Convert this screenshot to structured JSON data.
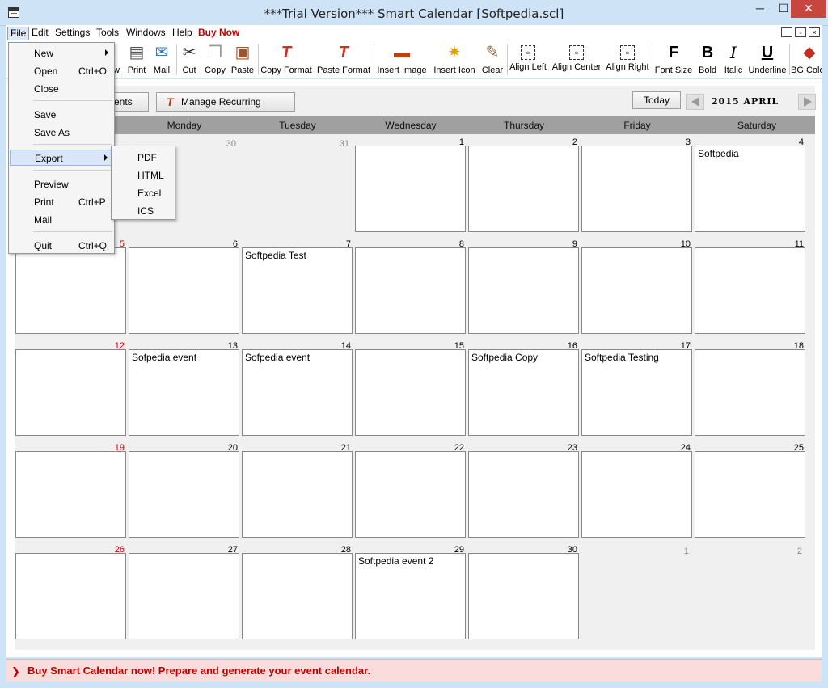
{
  "window": {
    "title": "***Trial Version*** Smart Calendar [Softpedia.scl]",
    "min": "─",
    "max": "☐",
    "close": "✕"
  },
  "menu": {
    "file": "File",
    "edit": "Edit",
    "settings": "Settings",
    "tools": "Tools",
    "windows": "Windows",
    "help": "Help",
    "buy": "Buy Now"
  },
  "mdi": {
    "min": "_",
    "restore": "▫",
    "close": "×"
  },
  "toolbar": [
    {
      "label": "w",
      "icon": ""
    },
    {
      "label": "Print",
      "icon": "▤"
    },
    {
      "label": "Mail",
      "icon": "✉"
    },
    {
      "label": "Cut",
      "icon": "✂"
    },
    {
      "label": "Copy",
      "icon": "❐"
    },
    {
      "label": "Paste",
      "icon": "▣"
    },
    {
      "label": "Copy Format",
      "icon": "T"
    },
    {
      "label": "Paste Format",
      "icon": "T"
    },
    {
      "label": "Insert Image",
      "icon": "▬"
    },
    {
      "label": "Insert Icon",
      "icon": "✷"
    },
    {
      "label": "Clear",
      "icon": "✎"
    },
    {
      "label": "Align Left",
      "icon": "▫"
    },
    {
      "label": "Align Center",
      "icon": "▫"
    },
    {
      "label": "Align Right",
      "icon": "▫"
    },
    {
      "label": "Font Size",
      "icon": "F"
    },
    {
      "label": "Bold",
      "icon": "B"
    },
    {
      "label": "Italic",
      "icon": "I"
    },
    {
      "label": "Underline",
      "icon": "U"
    },
    {
      "label": "BG Colo",
      "icon": "◆"
    }
  ],
  "calendar": {
    "events_button_partial": "ents",
    "recurring_button": "Manage Recurring Events",
    "today_button": "Today",
    "month_label": "2015 APRIL",
    "days": [
      "Monday",
      "Tuesday",
      "Wednesday",
      "Thursday",
      "Friday",
      "Saturday"
    ],
    "weeks": [
      [
        {
          "n": "",
          "ev": ""
        },
        {
          "n": "30",
          "ev": "",
          "other": true
        },
        {
          "n": "31",
          "ev": "",
          "other": true
        },
        {
          "n": "1",
          "ev": ""
        },
        {
          "n": "2",
          "ev": ""
        },
        {
          "n": "3",
          "ev": ""
        },
        {
          "n": "4",
          "ev": "Softpedia"
        }
      ],
      [
        {
          "n": "5",
          "ev": "",
          "sun": true
        },
        {
          "n": "6",
          "ev": ""
        },
        {
          "n": "7",
          "ev": "Softpedia Test"
        },
        {
          "n": "8",
          "ev": ""
        },
        {
          "n": "9",
          "ev": ""
        },
        {
          "n": "10",
          "ev": ""
        },
        {
          "n": "11",
          "ev": ""
        }
      ],
      [
        {
          "n": "12",
          "ev": "",
          "sun": true
        },
        {
          "n": "13",
          "ev": "Sofpedia event"
        },
        {
          "n": "14",
          "ev": "Sofpedia event"
        },
        {
          "n": "15",
          "ev": ""
        },
        {
          "n": "16",
          "ev": "Softpedia Copy"
        },
        {
          "n": "17",
          "ev": "Softpedia Testing"
        },
        {
          "n": "18",
          "ev": ""
        }
      ],
      [
        {
          "n": "19",
          "ev": "",
          "sun": true
        },
        {
          "n": "20",
          "ev": ""
        },
        {
          "n": "21",
          "ev": ""
        },
        {
          "n": "22",
          "ev": ""
        },
        {
          "n": "23",
          "ev": ""
        },
        {
          "n": "24",
          "ev": ""
        },
        {
          "n": "25",
          "ev": ""
        }
      ],
      [
        {
          "n": "26",
          "ev": "",
          "sun": true
        },
        {
          "n": "27",
          "ev": ""
        },
        {
          "n": "28",
          "ev": ""
        },
        {
          "n": "29",
          "ev": "Softpedia event 2"
        },
        {
          "n": "30",
          "ev": ""
        },
        {
          "n": "1",
          "ev": "",
          "other": true
        },
        {
          "n": "2",
          "ev": "",
          "other": true
        }
      ]
    ]
  },
  "file_menu": {
    "new": "New",
    "open": "Open",
    "open_sc": "Ctrl+O",
    "close": "Close",
    "save": "Save",
    "save_as": "Save As",
    "export": "Export",
    "preview": "Preview",
    "print": "Print",
    "print_sc": "Ctrl+P",
    "mail": "Mail",
    "quit": "Quit",
    "quit_sc": "Ctrl+Q"
  },
  "export_menu": [
    "PDF",
    "HTML",
    "Excel",
    "ICS"
  ],
  "status": {
    "icon": "❯",
    "text": "Buy Smart Calendar now! Prepare and generate your event calendar."
  },
  "colors": {
    "accent_red": "#c00000",
    "status_bg": "#fbdcdc",
    "header_gray": "#a0a0a0"
  }
}
